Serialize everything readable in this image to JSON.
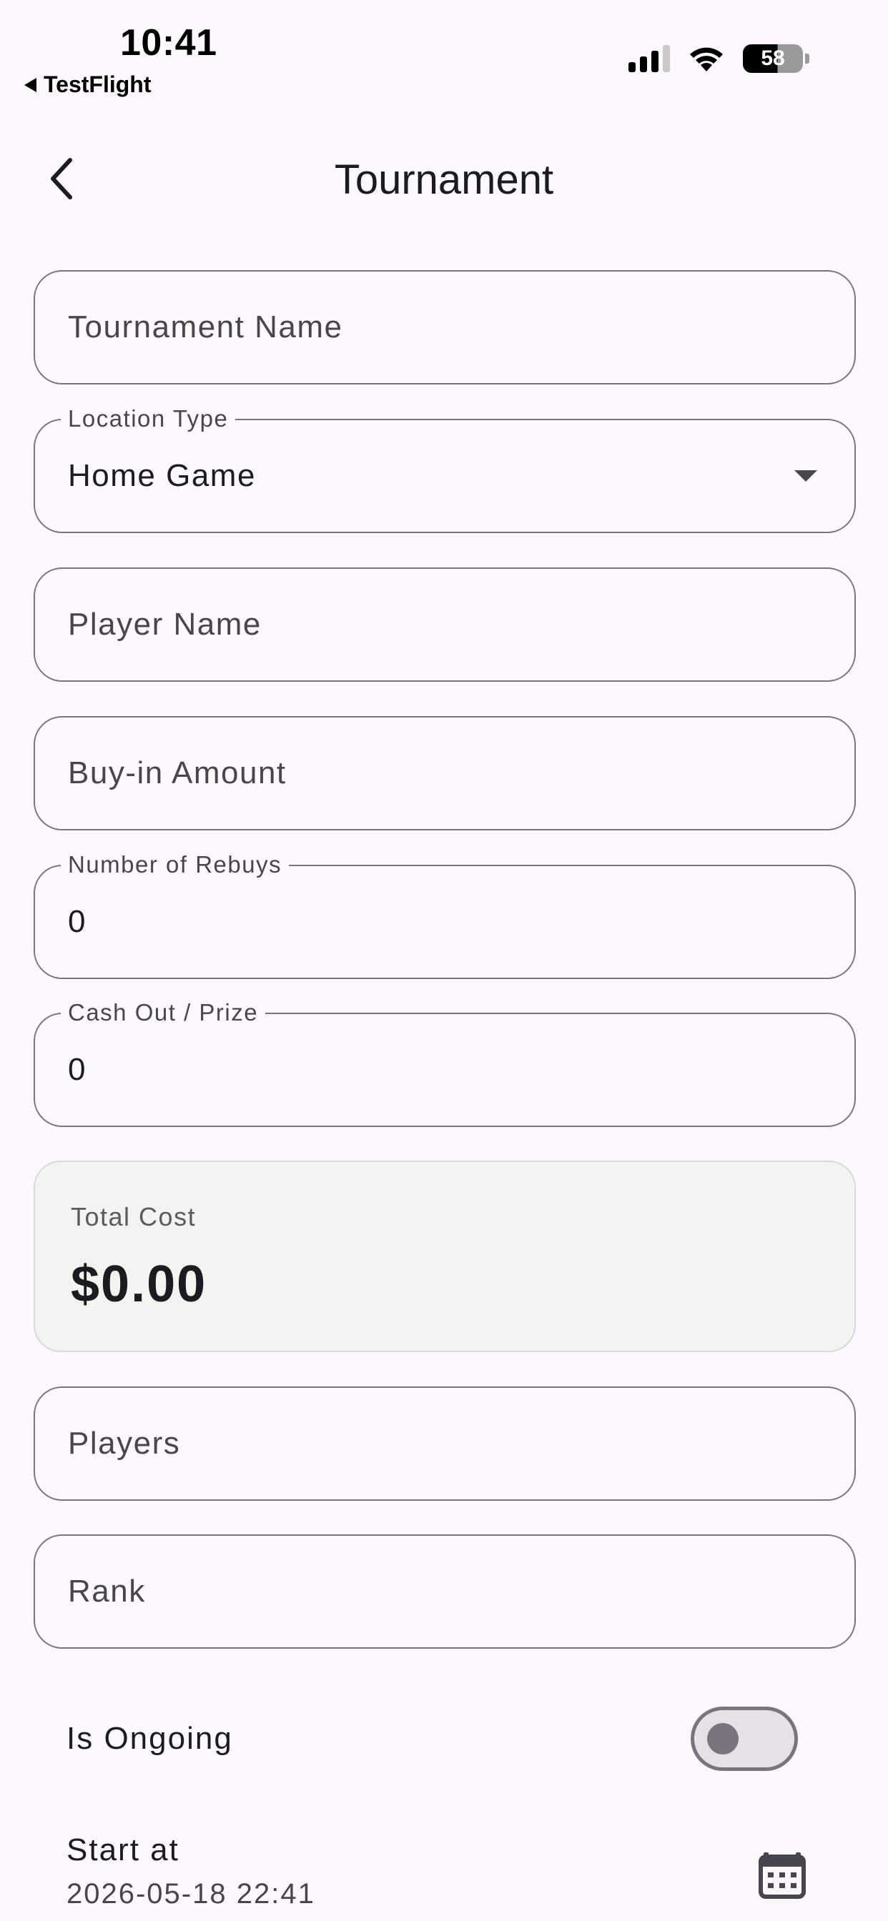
{
  "status_bar": {
    "time": "10:41",
    "back_app_label": "TestFlight",
    "battery": "58"
  },
  "app_bar": {
    "title": "Tournament"
  },
  "form": {
    "tournament_name": {
      "placeholder": "Tournament Name",
      "value": ""
    },
    "location_type": {
      "label": "Location Type",
      "value": "Home Game"
    },
    "player_name": {
      "placeholder": "Player Name",
      "value": ""
    },
    "buy_in_amount": {
      "placeholder": "Buy-in Amount",
      "value": ""
    },
    "number_of_rebuys": {
      "label": "Number of Rebuys",
      "value": "0"
    },
    "cash_out_prize": {
      "label": "Cash Out / Prize",
      "value": "0"
    },
    "total_cost": {
      "label": "Total Cost",
      "value": "$0.00"
    },
    "players": {
      "placeholder": "Players",
      "value": ""
    },
    "rank": {
      "placeholder": "Rank",
      "value": ""
    },
    "is_ongoing": {
      "label": "Is Ongoing",
      "checked": false
    },
    "start_at": {
      "label": "Start at",
      "value": "2026-05-18 22:41"
    }
  },
  "icons": {
    "back": "chevron-left-icon",
    "dropdown": "arrow-drop-down-icon",
    "calendar": "calendar-icon",
    "signal": "cellular-signal-icon",
    "wifi": "wifi-icon",
    "battery": "battery-icon"
  },
  "colors": {
    "background": "#fdf8fd",
    "outline": "#79747e",
    "card_background": "#f3f3f2",
    "text": "#1c1b1f",
    "muted_text": "#49454f"
  }
}
